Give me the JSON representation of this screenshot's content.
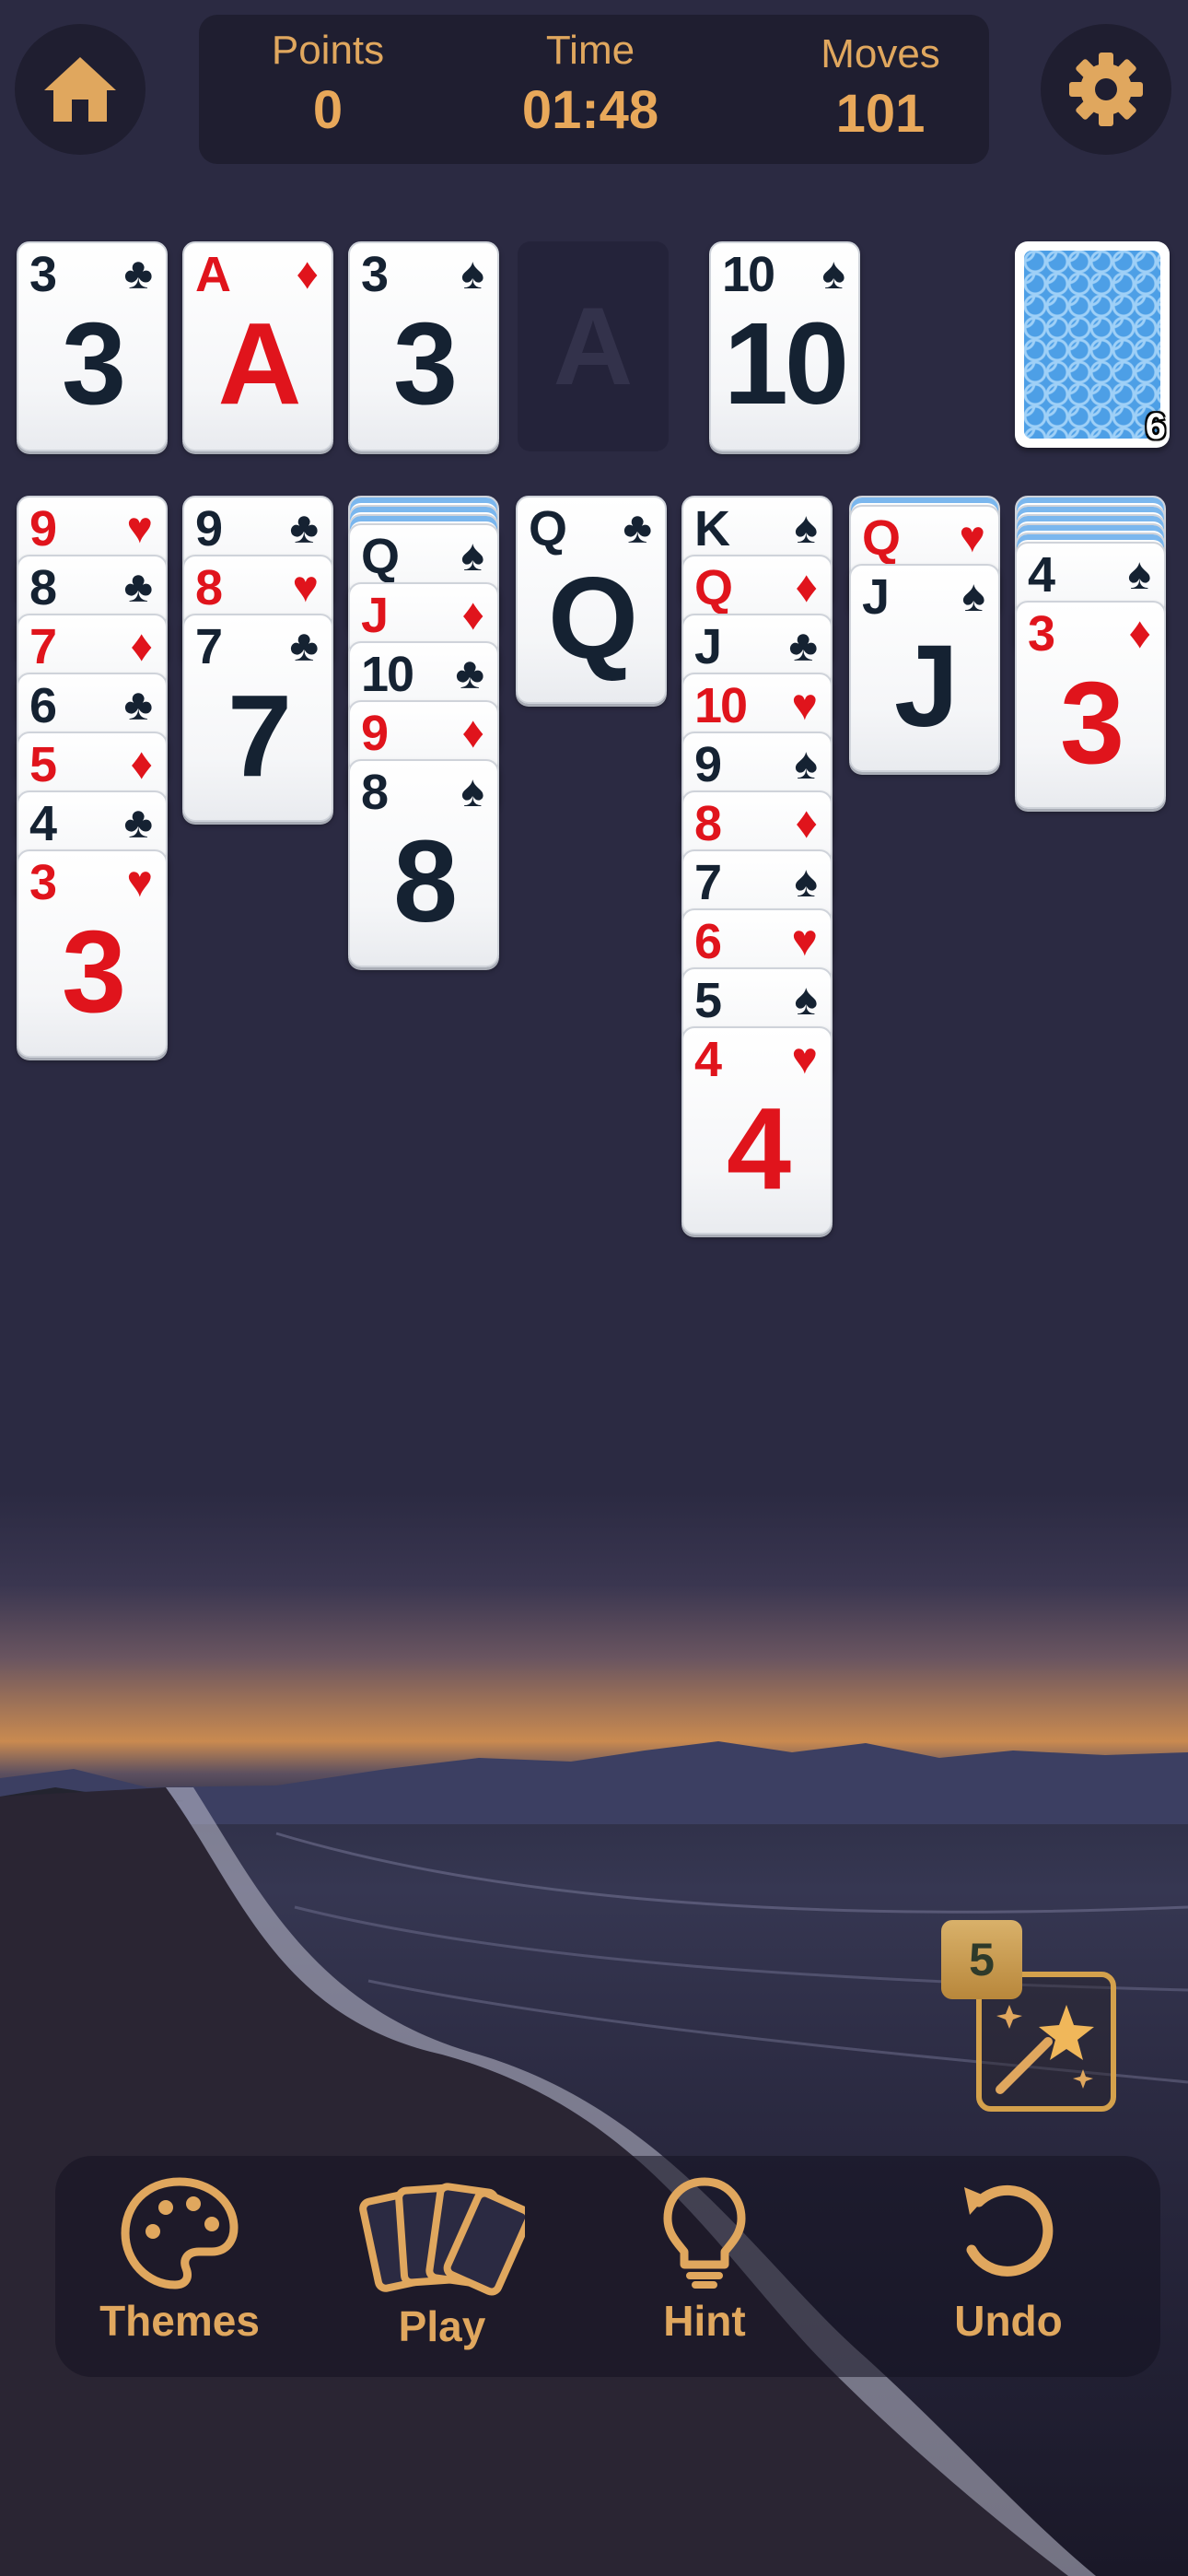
{
  "header": {
    "points_label": "Points",
    "points_value": "0",
    "time_label": "Time",
    "time_value": "01:48",
    "moves_label": "Moves",
    "moves_value": "101"
  },
  "foundations": [
    {
      "rank": "3",
      "suit": "♣",
      "color": "black"
    },
    {
      "rank": "A",
      "suit": "♦",
      "color": "red"
    },
    {
      "rank": "3",
      "suit": "♠",
      "color": "black"
    },
    {
      "empty_label": "A"
    }
  ],
  "waste": {
    "rank": "10",
    "suit": "♠",
    "color": "black"
  },
  "stock": {
    "count": "6"
  },
  "tableau": [
    {
      "facedown": 0,
      "cards": [
        {
          "rank": "9",
          "suit": "♥",
          "color": "red"
        },
        {
          "rank": "8",
          "suit": "♣",
          "color": "black"
        },
        {
          "rank": "7",
          "suit": "♦",
          "color": "red"
        },
        {
          "rank": "6",
          "suit": "♣",
          "color": "black"
        },
        {
          "rank": "5",
          "suit": "♦",
          "color": "red"
        },
        {
          "rank": "4",
          "suit": "♣",
          "color": "black"
        },
        {
          "rank": "3",
          "suit": "♥",
          "color": "red"
        }
      ]
    },
    {
      "facedown": 0,
      "cards": [
        {
          "rank": "9",
          "suit": "♣",
          "color": "black"
        },
        {
          "rank": "8",
          "suit": "♥",
          "color": "red"
        },
        {
          "rank": "7",
          "suit": "♣",
          "color": "black"
        }
      ]
    },
    {
      "facedown": 3,
      "cards": [
        {
          "rank": "Q",
          "suit": "♠",
          "color": "black"
        },
        {
          "rank": "J",
          "suit": "♦",
          "color": "red"
        },
        {
          "rank": "10",
          "suit": "♣",
          "color": "black"
        },
        {
          "rank": "9",
          "suit": "♦",
          "color": "red"
        },
        {
          "rank": "8",
          "suit": "♠",
          "color": "black"
        }
      ]
    },
    {
      "facedown": 0,
      "cards": [
        {
          "rank": "Q",
          "suit": "♣",
          "color": "black"
        }
      ]
    },
    {
      "facedown": 0,
      "cards": [
        {
          "rank": "K",
          "suit": "♠",
          "color": "black"
        },
        {
          "rank": "Q",
          "suit": "♦",
          "color": "red"
        },
        {
          "rank": "J",
          "suit": "♣",
          "color": "black"
        },
        {
          "rank": "10",
          "suit": "♥",
          "color": "red"
        },
        {
          "rank": "9",
          "suit": "♠",
          "color": "black"
        },
        {
          "rank": "8",
          "suit": "♦",
          "color": "red"
        },
        {
          "rank": "7",
          "suit": "♠",
          "color": "black"
        },
        {
          "rank": "6",
          "suit": "♥",
          "color": "red"
        },
        {
          "rank": "5",
          "suit": "♠",
          "color": "black"
        },
        {
          "rank": "4",
          "suit": "♥",
          "color": "red"
        }
      ]
    },
    {
      "facedown": 1,
      "cards": [
        {
          "rank": "Q",
          "suit": "♥",
          "color": "red"
        },
        {
          "rank": "J",
          "suit": "♠",
          "color": "black"
        }
      ]
    },
    {
      "facedown": 5,
      "cards": [
        {
          "rank": "4",
          "suit": "♠",
          "color": "black"
        },
        {
          "rank": "3",
          "suit": "♦",
          "color": "red"
        }
      ]
    }
  ],
  "magic_wand": {
    "count": "5",
    "icon": "magic-wand-icon"
  },
  "bottom_nav": {
    "themes_label": "Themes",
    "play_label": "Play",
    "hint_label": "Hint",
    "undo_label": "Undo"
  },
  "colors": {
    "accent": "#e0a75e",
    "panel": "#1f1e30",
    "card_red": "#e0141c",
    "card_black": "#152232"
  }
}
